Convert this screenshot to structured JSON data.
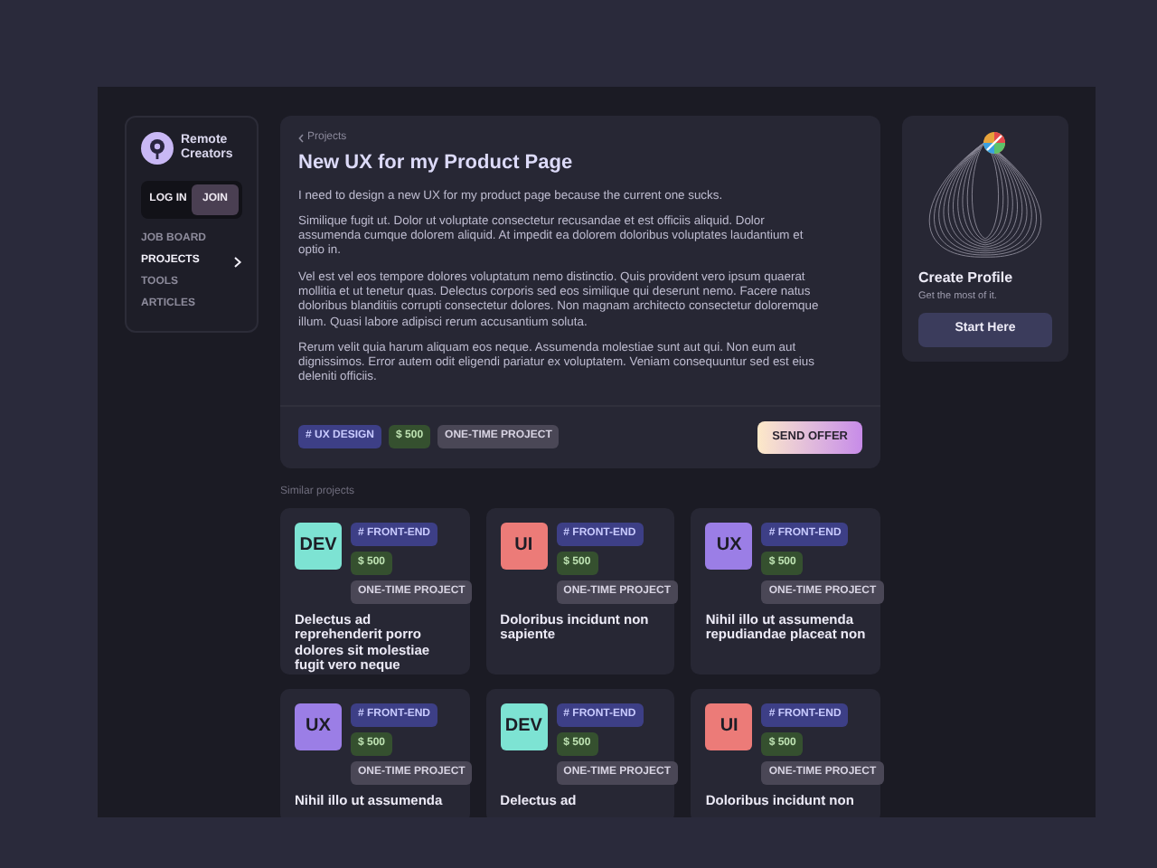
{
  "brand": {
    "name_line_1": "Remote",
    "name_line_2": "Creators"
  },
  "auth": [
    {
      "label": "LOG IN",
      "selected": false
    },
    {
      "label": "JOIN",
      "selected": true
    }
  ],
  "nav": [
    {
      "label": "JOB BOARD",
      "selected": false
    },
    {
      "label": "PROJECTS",
      "selected": true
    },
    {
      "label": "TOOLS",
      "selected": false
    },
    {
      "label": "ARTICLES",
      "selected": false
    }
  ],
  "project": {
    "breadcrumb": "Projects",
    "title": "New UX for my Product Page",
    "paragraphs": [
      "I need to design a new UX for my product page because the current one sucks.",
      "Similique fugit ut. Dolor ut voluptate consectetur recusandae et est officiis aliquid. Dolor assumenda cumque dolorem aliquid. At impedit ea dolorem doloribus voluptates laudantium et optio in.",
      "Vel est vel eos tempore dolores voluptatum nemo distinctio. Quis provident vero ipsum quaerat mollitia et ut tenetur quas. Delectus corporis sed eos similique qui deserunt nemo. Facere natus doloribus blanditiis corrupti consectetur dolores. Non magnam architecto consectetur doloremque illum. Quasi labore adipisci rerum accusantium soluta.",
      "Rerum velit quia harum aliquam eos neque. Assumenda molestiae sunt aut qui. Non eum aut dignissimos. Error autem odit eligendi pariatur ex voluptatem. Veniam consequuntur sed est eius deleniti officiis."
    ],
    "tags": {
      "category": "# UX DESIGN",
      "price": "$ 500",
      "type": "ONE-TIME PROJECT"
    },
    "action": "SEND OFFER"
  },
  "profile_card": {
    "title": "Create Profile",
    "subtitle": "Get the most of it.",
    "button": "Start Here"
  },
  "similar": {
    "heading": "Similar projects",
    "cards": [
      {
        "badge": "DEV",
        "color": "#7de3d3",
        "category": "# FRONT-END",
        "price": "$ 500",
        "type": "ONE-TIME PROJECT",
        "title": "Delectus ad reprehenderit porro dolores sit molestiae fugit vero neque"
      },
      {
        "badge": "UI",
        "color": "#ec7b78",
        "category": "# FRONT-END",
        "price": "$ 500",
        "type": "ONE-TIME PROJECT",
        "title": "Doloribus incidunt non sapiente"
      },
      {
        "badge": "UX",
        "color": "#9b7ee6",
        "category": "# FRONT-END",
        "price": "$ 500",
        "type": "ONE-TIME PROJECT",
        "title": "Nihil illo ut assumenda repudiandae placeat non"
      },
      {
        "badge": "UX",
        "color": "#9b7ee6",
        "category": "# FRONT-END",
        "price": "$ 500",
        "type": "ONE-TIME PROJECT",
        "title": "Nihil illo ut assumenda"
      },
      {
        "badge": "DEV",
        "color": "#7de3d3",
        "category": "# FRONT-END",
        "price": "$ 500",
        "type": "ONE-TIME PROJECT",
        "title": "Delectus ad"
      },
      {
        "badge": "UI",
        "color": "#ec7b78",
        "category": "# FRONT-END",
        "price": "$ 500",
        "type": "ONE-TIME PROJECT",
        "title": "Doloribus incidunt non"
      }
    ]
  }
}
